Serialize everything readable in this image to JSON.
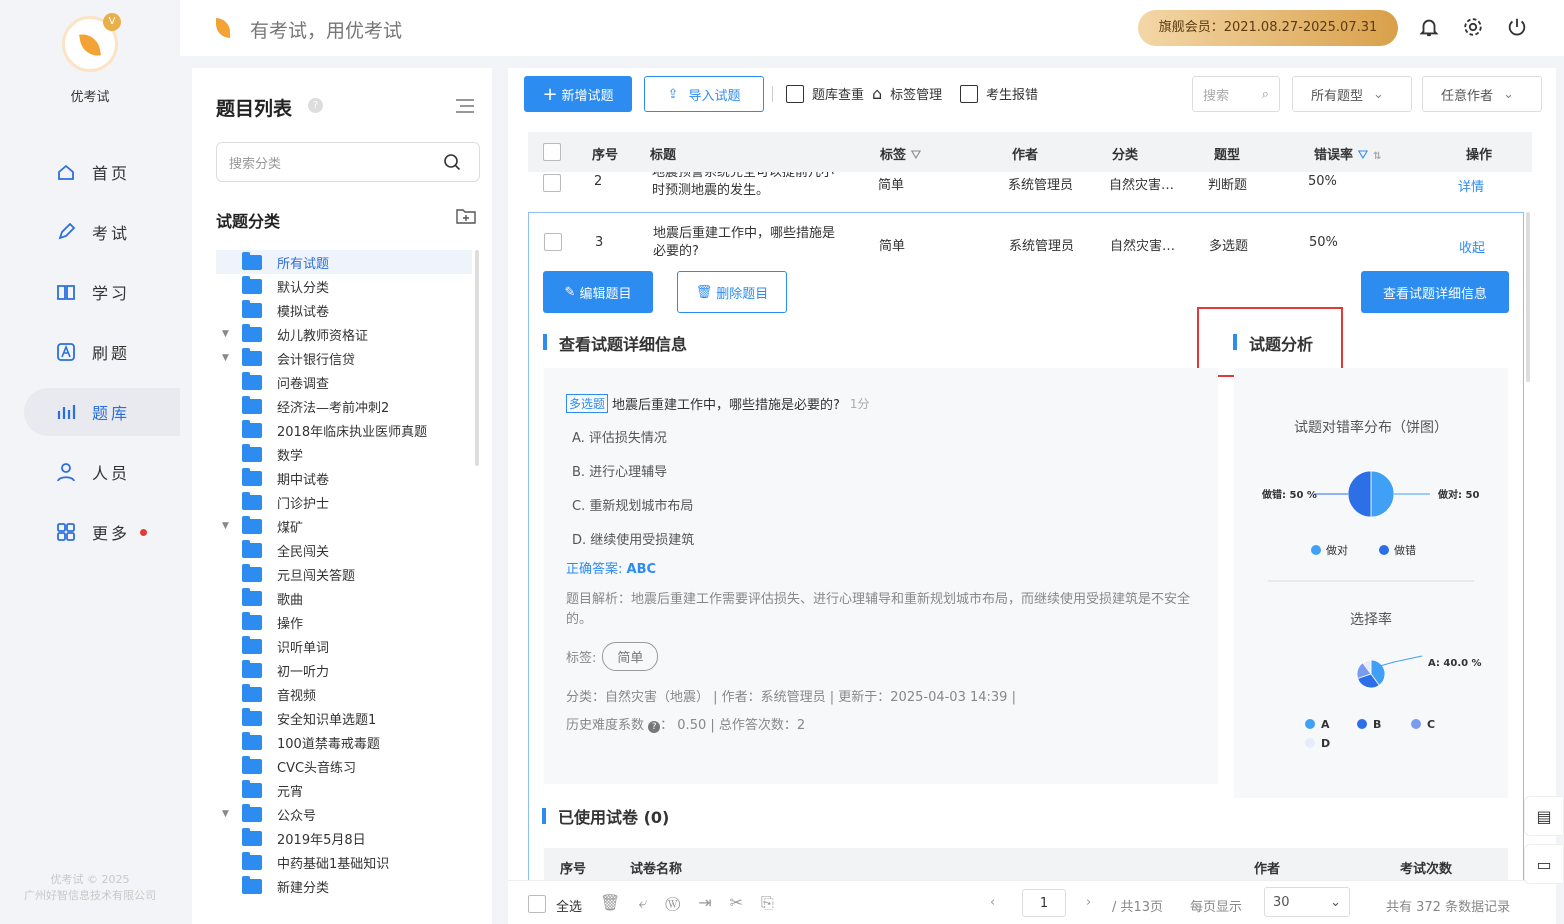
{
  "app": {
    "name": "优考试",
    "copyright_line1": "优考试 © 2025",
    "copyright_line2": "广州好智信息技术有限公司"
  },
  "nav": {
    "items": [
      {
        "label": "首页",
        "icon": "home-icon",
        "active": false
      },
      {
        "label": "考试",
        "icon": "pen-icon",
        "active": false
      },
      {
        "label": "学习",
        "icon": "book-icon",
        "active": false
      },
      {
        "label": "刷题",
        "icon": "letter-a-icon",
        "active": false
      },
      {
        "label": "题库",
        "icon": "bar-chart-icon",
        "active": true
      },
      {
        "label": "人员",
        "icon": "user-icon",
        "active": false
      },
      {
        "label": "更多",
        "icon": "grid-icon",
        "active": false
      }
    ]
  },
  "header": {
    "slogan": "有考试，用优考试",
    "member": "旗舰会员：2021.08.27-2025.07.31"
  },
  "sidebar": {
    "title": "题目列表",
    "search_placeholder": "搜索分类",
    "category_title": "试题分类",
    "tree": [
      {
        "label": "所有试题",
        "selected": true,
        "arrow": false
      },
      {
        "label": "默认分类",
        "arrow": false
      },
      {
        "label": "模拟试卷",
        "arrow": false
      },
      {
        "label": "幼儿教师资格证",
        "arrow": true
      },
      {
        "label": "会计银行信贷",
        "arrow": true
      },
      {
        "label": "问卷调查",
        "arrow": false
      },
      {
        "label": "经济法—考前冲刺2",
        "arrow": false
      },
      {
        "label": "2018年临床执业医师真题",
        "arrow": false
      },
      {
        "label": "数学",
        "arrow": false
      },
      {
        "label": "期中试卷",
        "arrow": false
      },
      {
        "label": "门诊护士",
        "arrow": false
      },
      {
        "label": "煤矿",
        "arrow": true
      },
      {
        "label": "全民闯关",
        "arrow": false
      },
      {
        "label": "元旦闯关答题",
        "arrow": false
      },
      {
        "label": "歌曲",
        "arrow": false
      },
      {
        "label": "操作",
        "arrow": false
      },
      {
        "label": "识听单词",
        "arrow": false
      },
      {
        "label": "初一听力",
        "arrow": false
      },
      {
        "label": "音视频",
        "arrow": false
      },
      {
        "label": "安全知识单选题1",
        "arrow": false
      },
      {
        "label": "100道禁毒戒毒题",
        "arrow": false
      },
      {
        "label": "CVC头音练习",
        "arrow": false
      },
      {
        "label": "元宵",
        "arrow": false
      },
      {
        "label": "公众号",
        "arrow": true
      },
      {
        "label": "2019年5月8日",
        "arrow": false
      },
      {
        "label": "中药基础1基础知识",
        "arrow": false
      },
      {
        "label": "新建分类",
        "arrow": false
      }
    ]
  },
  "toolbar": {
    "add": "新增试题",
    "import": "导入试题",
    "dedupe": "题库查重",
    "tags": "标签管理",
    "report": "考生报错",
    "search_placeholder": "搜索",
    "type_filter": "所有题型",
    "author_filter": "任意作者"
  },
  "table": {
    "headers": {
      "no": "序号",
      "title": "标题",
      "tag": "标签",
      "author": "作者",
      "category": "分类",
      "type": "题型",
      "error_rate": "错误率",
      "action": "操作"
    },
    "rows": [
      {
        "no": "2",
        "title_line1": "地震预警系统完全可以提前几小",
        "title_line2": "时预测地震的发生。",
        "tag": "简单",
        "author": "系统管理员",
        "category": "自然灾害…",
        "type": "判断题",
        "rate": "50%",
        "action": "详情"
      },
      {
        "no": "3",
        "title_line1": "地震后重建工作中，哪些措施是",
        "title_line2": "必要的?",
        "tag": "简单",
        "author": "系统管理员",
        "category": "自然灾害…",
        "type": "多选题",
        "rate": "50%",
        "action": "收起"
      }
    ]
  },
  "detail": {
    "edit": "编辑题目",
    "delete": "删除题目",
    "view_detail": "查看试题详细信息",
    "section_title": "查看试题详细信息",
    "analysis_title": "试题分析",
    "question_type": "多选题",
    "question": "地震后重建工作中，哪些措施是必要的?",
    "score": "1分",
    "options": [
      "A. 评估损失情况",
      "B. 进行心理辅导",
      "C. 重新规划城市布局",
      "D. 继续使用受损建筑"
    ],
    "answer_label": "正确答案:",
    "answer": "ABC",
    "explanation": "题目解析：地震后重建工作需要评估损失、进行心理辅导和重新规划城市布局，而继续使用受损建筑是不安全的。",
    "tag_label": "标签:",
    "tag": "简单",
    "meta": "分类：自然灾害（地震） | 作者：系统管理员 | 更新于：2025-04-03 14:39 |",
    "difficulty_label": "历史难度系数",
    "difficulty_rest": "： 0.50 | 总作答次数：2",
    "used_title": "已使用试卷",
    "used_count": "(0)",
    "used_headers": {
      "no": "序号",
      "name": "试卷名称",
      "author": "作者",
      "count": "考试次数"
    }
  },
  "chart_data": [
    {
      "type": "pie",
      "title": "试题对错率分布（饼图）",
      "categories": [
        "做对",
        "做错"
      ],
      "values": [
        50,
        50
      ],
      "labels": [
        "做对: 50",
        "做错: 50 %"
      ],
      "colors": [
        "#3fa0f5",
        "#2d6fe6"
      ],
      "legend": "bottom"
    },
    {
      "type": "pie",
      "title": "选择率",
      "categories": [
        "A",
        "B",
        "C",
        "D"
      ],
      "values": [
        40,
        30,
        20,
        10
      ],
      "labels": [
        "A: 40.0 %"
      ],
      "colors": [
        "#3fa0f5",
        "#2d6fe6",
        "#7a9cf0",
        "#e6ecfa"
      ],
      "legend": "bottom"
    }
  ],
  "footer": {
    "select_all": "全选",
    "page": "1",
    "total_pages": "/ 共13页",
    "per_page_label": "每页显示",
    "per_page": "30",
    "total": "共有 372 条数据记录"
  }
}
